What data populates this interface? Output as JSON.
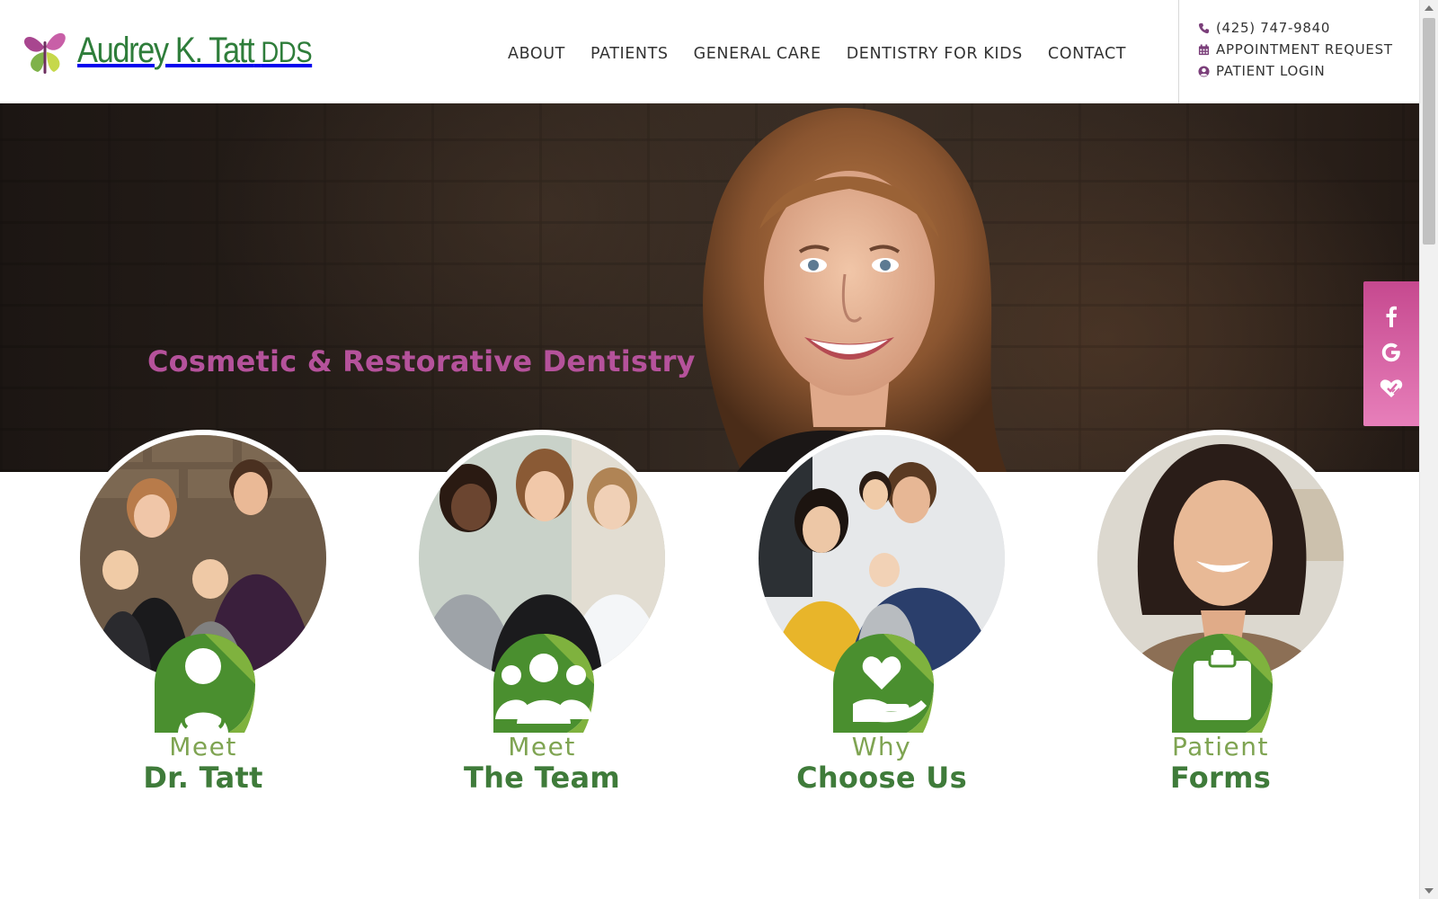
{
  "logo": {
    "name": "Audrey K. Tatt",
    "suffix": "DDS"
  },
  "nav": [
    "ABOUT",
    "PATIENTS",
    "GENERAL CARE",
    "DENTISTRY FOR KIDS",
    "CONTACT"
  ],
  "contact": {
    "phone": "(425) 747-9840",
    "appointment": "APPOINTMENT REQUEST",
    "login": "PATIENT LOGIN"
  },
  "hero": {
    "title": "Cosmetic & Restorative Dentistry"
  },
  "social": [
    "facebook-icon",
    "google-icon",
    "healthgrades-icon"
  ],
  "cards": [
    {
      "line1": "Meet",
      "line2": "Dr. Tatt",
      "icon": "doctor-icon"
    },
    {
      "line1": "Meet",
      "line2": "The Team",
      "icon": "team-icon"
    },
    {
      "line1": "Why",
      "line2": "Choose Us",
      "icon": "heart-hand-icon"
    },
    {
      "line1": "Patient",
      "line2": "Forms",
      "icon": "clipboard-icon"
    }
  ],
  "colors": {
    "brand_green": "#3f7b3a",
    "light_green": "#7fa452",
    "accent_pink": "#b5529b",
    "nav_text": "#333333"
  }
}
